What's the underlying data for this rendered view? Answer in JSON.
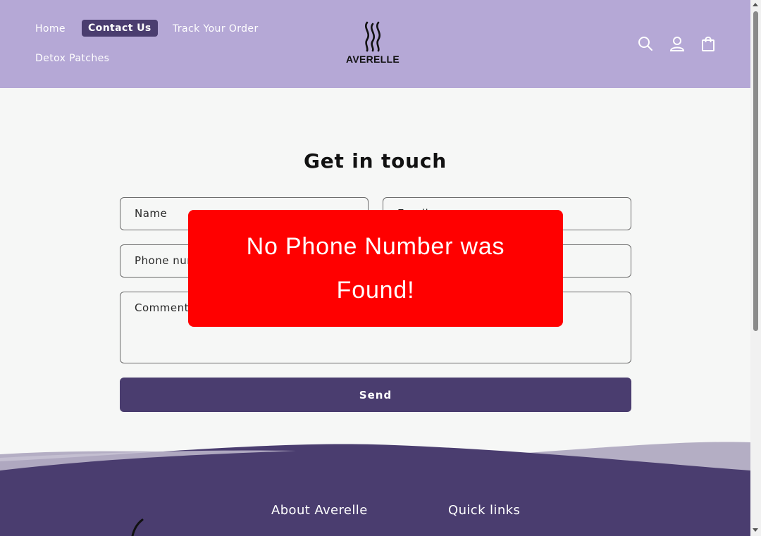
{
  "nav": {
    "items": [
      {
        "label": "Home"
      },
      {
        "label": "Contact Us"
      },
      {
        "label": "Track Your Order"
      },
      {
        "label": "Detox Patches"
      }
    ],
    "active": "Contact Us"
  },
  "brand": {
    "name": "AVERELLE",
    "icon": "flame-wave-logo"
  },
  "header_icons": [
    "search-icon",
    "account-icon",
    "cart-icon"
  ],
  "form": {
    "title": "Get in touch",
    "name_placeholder": "Name",
    "email_placeholder": "Email",
    "phone_placeholder": "Phone number",
    "comment_placeholder": "Comment",
    "send_label": "Send"
  },
  "popup": {
    "message": "No Phone Number was Found!"
  },
  "footer": {
    "about_heading": "About Averelle",
    "links_heading": "Quick links"
  },
  "colors": {
    "header_bg": "#b5a8d6",
    "accent": "#4a3d6f",
    "popup_bg": "#ff0000",
    "page_bg": "#f6f7f6"
  }
}
